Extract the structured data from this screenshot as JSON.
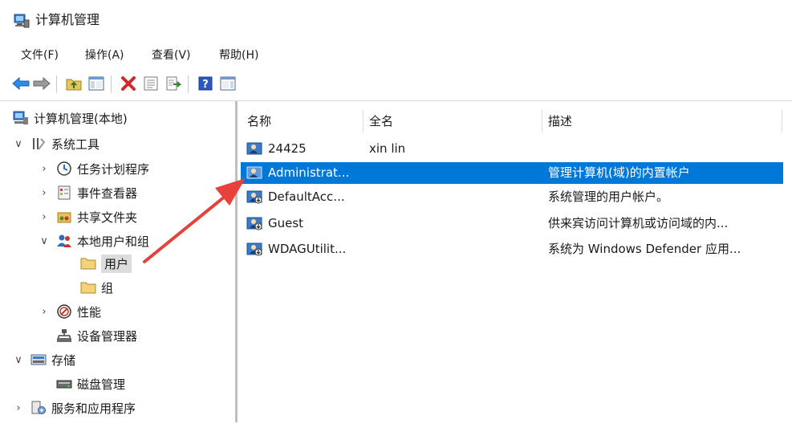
{
  "window": {
    "title": "计算机管理"
  },
  "menu": [
    "文件(F)",
    "操作(A)",
    "查看(V)",
    "帮助(H)"
  ],
  "tree": [
    {
      "label": "计算机管理(本地)",
      "chevron": "",
      "icon": "computer-mgmt-icon"
    },
    {
      "label": "系统工具",
      "chevron": "∨",
      "icon": "tools-icon"
    },
    {
      "label": "任务计划程序",
      "chevron": "›",
      "icon": "clock-icon"
    },
    {
      "label": "事件查看器",
      "chevron": "›",
      "icon": "event-viewer-icon"
    },
    {
      "label": "共享文件夹",
      "chevron": "›",
      "icon": "shared-folder-icon"
    },
    {
      "label": "本地用户和组",
      "chevron": "∨",
      "icon": "users-group-icon"
    },
    {
      "label": "用户",
      "chevron": "",
      "icon": "folder-icon"
    },
    {
      "label": "组",
      "chevron": "",
      "icon": "folder-icon"
    },
    {
      "label": "性能",
      "chevron": "›",
      "icon": "performance-icon"
    },
    {
      "label": "设备管理器",
      "chevron": "",
      "icon": "device-manager-icon"
    },
    {
      "label": "存储",
      "chevron": "∨",
      "icon": "storage-icon"
    },
    {
      "label": "磁盘管理",
      "chevron": "",
      "icon": "disk-icon"
    },
    {
      "label": "服务和应用程序",
      "chevron": "›",
      "icon": "services-icon"
    }
  ],
  "columns": {
    "name": "名称",
    "fullname": "全名",
    "desc": "描述"
  },
  "rows": [
    {
      "name": "24425",
      "fullname": "xin lin",
      "desc": ""
    },
    {
      "name": "Administrat...",
      "fullname": "",
      "desc": "管理计算机(域)的内置帐户"
    },
    {
      "name": "DefaultAcc...",
      "fullname": "",
      "desc": "系统管理的用户帐户。"
    },
    {
      "name": "Guest",
      "fullname": "",
      "desc": "供来宾访问计算机或访问域的内..."
    },
    {
      "name": "WDAGUtilit...",
      "fullname": "",
      "desc": "系统为 Windows Defender 应用..."
    }
  ],
  "colors": {
    "selection": "#0078d7",
    "arrow": "#e8403a"
  }
}
